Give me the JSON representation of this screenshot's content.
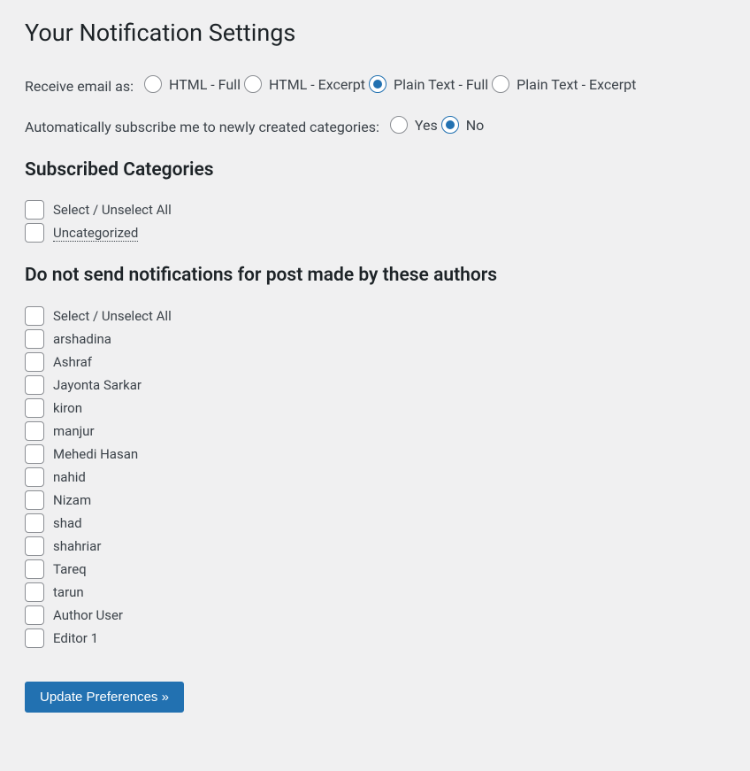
{
  "page_title": "Your Notification Settings",
  "email_format": {
    "label": "Receive email as:",
    "selected_index": 2,
    "options": [
      "HTML - Full",
      "HTML - Excerpt",
      "Plain Text - Full",
      "Plain Text - Excerpt"
    ]
  },
  "auto_subscribe": {
    "label": "Automatically subscribe me to newly created categories:",
    "selected_index": 1,
    "options": [
      "Yes",
      "No"
    ]
  },
  "subscribed_categories": {
    "heading": "Subscribed Categories",
    "select_all_label": "Select / Unselect All",
    "items": [
      "Uncategorized"
    ]
  },
  "exclude_authors": {
    "heading": "Do not send notifications for post made by these authors",
    "select_all_label": "Select / Unselect All",
    "items": [
      "arshadina",
      "Ashraf",
      "Jayonta Sarkar",
      "kiron",
      "manjur",
      "Mehedi Hasan",
      "nahid",
      "Nizam",
      "shad",
      "shahriar",
      "Tareq",
      "tarun",
      "Author User",
      "Editor 1"
    ]
  },
  "submit_label": "Update Preferences »"
}
